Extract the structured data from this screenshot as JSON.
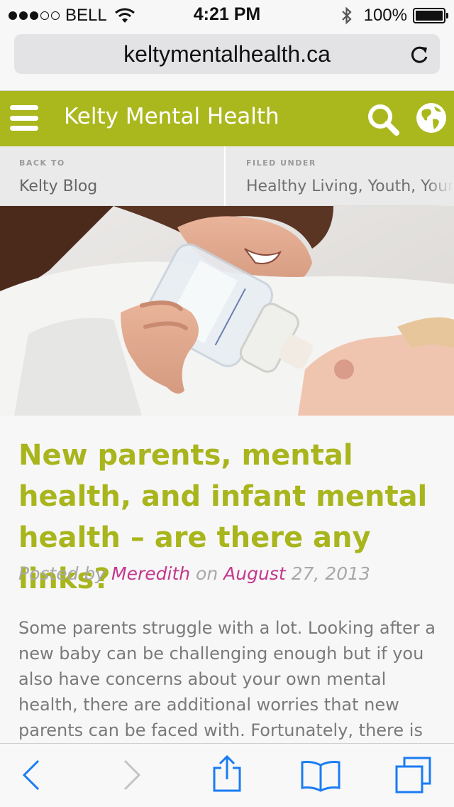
{
  "status_bar": {
    "carrier": "BELL",
    "signal_bars_filled": 3,
    "signal_bars_total": 5,
    "time": "4:21 PM",
    "battery": "100%",
    "battery_level": 1.0
  },
  "browser": {
    "url": "keltymentalhealth.ca"
  },
  "site": {
    "title": "Kelty Mental Health",
    "accent_color": "#aab81e",
    "link_color": "#c4388c"
  },
  "breadcrumbs": {
    "back_label": "BACK TO",
    "back_value": "Kelty Blog",
    "filed_label": "FILED UNDER",
    "filed_value": "Healthy Living, Youth, Young Adults"
  },
  "article": {
    "title": "New parents, mental health, and infant mental health – are there any links?",
    "meta": {
      "posted_by": "Posted by",
      "author": "Meredith",
      "on": "on",
      "month": "August",
      "day_year": "27, 2013"
    },
    "body": "Some parents struggle with a lot. Looking after a new baby can be challenging enough but if you also have concerns about your own mental health, there are additional worries that new parents can be faced with. Fortunately, there is"
  },
  "icons": {
    "menu": "menu-icon",
    "search": "search-icon",
    "globe": "globe-icon",
    "reload": "reload-icon",
    "back": "chevron-left-icon",
    "forward": "chevron-right-icon",
    "share": "share-icon",
    "bookmarks": "book-icon",
    "tabs": "tabs-icon"
  }
}
